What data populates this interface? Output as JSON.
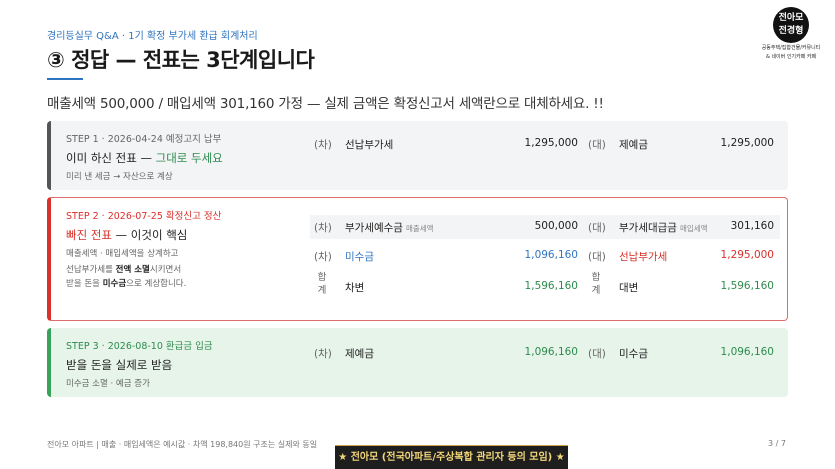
{
  "header": {
    "breadcrumb": "경리등실무 Q&A · 1기 확정 부가세 환급 회계처리",
    "title": "③ 정답 — 전표는 3단계입니다",
    "subtitle": "매출세액 500,000 / 매입세액 301,160 가정 — 실제 금액은 확정신고서 세액란으로 대체하세요. !!"
  },
  "logo": {
    "text_line1": "전아모",
    "text_line2": "전경형",
    "tagline_line1": "공동주택/집합건물/커뮤니티",
    "tagline_line2": "& 네이버 인기카페 카페"
  },
  "steps": [
    {
      "step": "STEP 1 · 2026-04-24 예정고지 납부",
      "title_main": "이미 하신 전표 — ",
      "title_hl": "그대로 두세요",
      "note": "미리 낸 세금 → 자산으로 계상",
      "debit_side": "(차)",
      "debit_account": "선납부가세",
      "debit_amount": "1,295,000",
      "credit_side": "(대)",
      "credit_account": "제예금",
      "credit_amount": "1,295,000"
    },
    {
      "step": "STEP 2 · 2026-07-25 확정신고 정산",
      "title_hl": "빠진 전표",
      "title_main": " — 이것이 핵심",
      "note_line1": "매출세액 · 매입세액을 상계하고",
      "note_line2_a": "선납부가세를 ",
      "note_line2_b": "전액 소멸",
      "note_line2_c": "시키면서",
      "note_line3_a": "받을 돈을 ",
      "note_line3_b": "미수금",
      "note_line3_c": "으로 계상합니다.",
      "rows": [
        {
          "debit_side": "(차)",
          "debit_account": "부가세예수금",
          "debit_tag": "매출세액",
          "debit_amount": "500,000",
          "credit_side": "(대)",
          "credit_account": "부가세대급금",
          "credit_tag": "매입세액",
          "credit_amount": "301,160"
        },
        {
          "debit_side": "(차)",
          "debit_account": "미수금",
          "debit_amount": "1,096,160",
          "credit_side": "(대)",
          "credit_account": "선납부가세",
          "credit_amount": "1,295,000"
        }
      ],
      "sum_label_a": "합",
      "sum_label_b": "계",
      "sum_debit_label": "차변",
      "sum_debit": "1,596,160",
      "sum_credit_label": "대변",
      "sum_credit": "1,596,160"
    },
    {
      "step": "STEP 3 · 2026-08-10 환급금 입금",
      "title_main": "받을 돈을 실제로 받음",
      "note": "미수금 소멸 · 예금 증가",
      "debit_side": "(차)",
      "debit_account": "제예금",
      "debit_amount": "1,096,160",
      "credit_side": "(대)",
      "credit_account": "미수금",
      "credit_amount": "1,096,160"
    }
  ],
  "footer": {
    "left": "전아모 아파트 | 매출 · 매입세액은 예시값 · 차액 198,840원 구조는 실제와 동일",
    "page": "3 / 7",
    "banner": "★ 전아모 (전국아파트/주상복합 관리자 등의 모임) ★"
  },
  "colors": {
    "accent_blue": "#2f74c0",
    "red": "#d9302a",
    "green": "#2e8b4d",
    "banner_bg": "#1e1e1e",
    "banner_text": "#f3d77a"
  }
}
